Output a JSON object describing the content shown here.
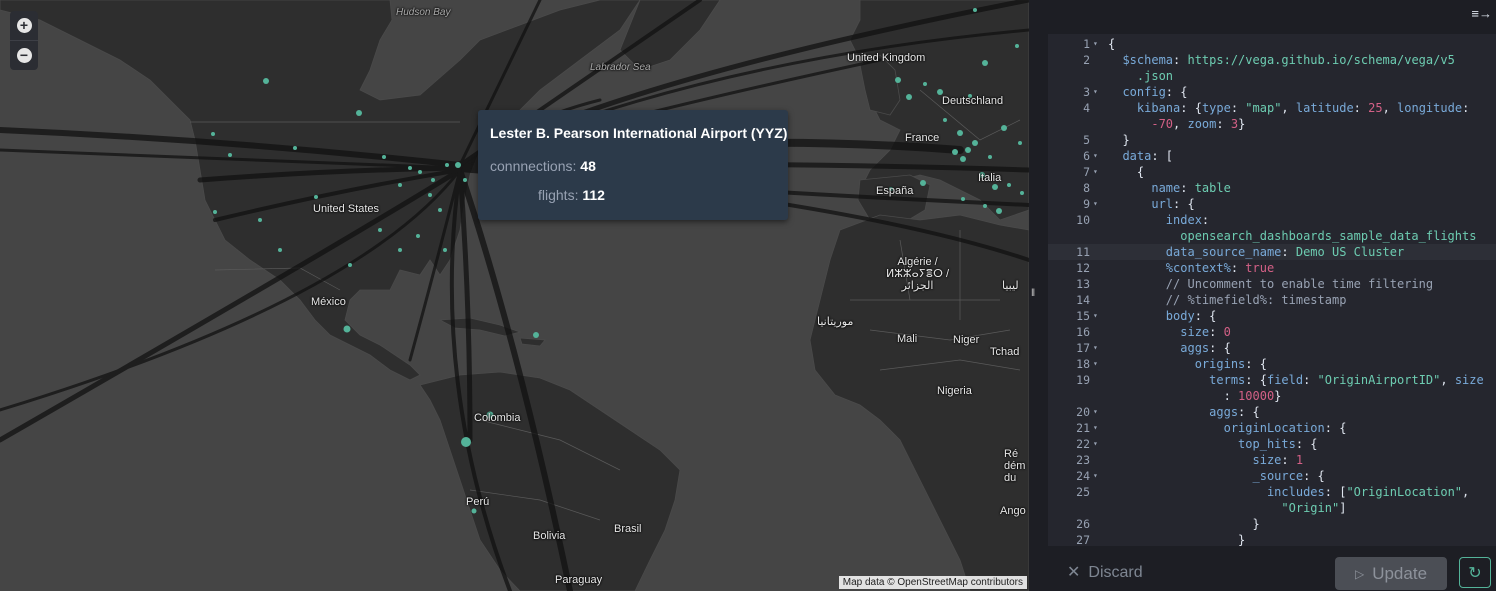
{
  "map": {
    "labels": {
      "hudson_bay": "Hudson\nBay",
      "labrador_sea": "Labrador\nSea",
      "united_kingdom": "United Kingdom",
      "deutschland": "Deutschland",
      "france": "France",
      "espana": "España",
      "italia": "Italia",
      "united_states": "United States",
      "mexico": "México",
      "algerie": "Algérie /\nⵍⵣⵣⴰⵢⴻⵔ /\nالجزائر",
      "libya": "ليبيا",
      "morocco": "موريتانيا",
      "mali": "Mali",
      "niger": "Niger",
      "tchad": "Tchad",
      "nigeria": "Nigeria",
      "colombia": "Colombia",
      "peru": "Perú",
      "bolivia": "Bolivia",
      "brasil": "Brasil",
      "paraguay": "Paraguay",
      "rdc": "Ré\ndém\ndu",
      "angola": "Ango"
    },
    "zoom_in_icon": "plus-icon",
    "zoom_out_icon": "minus-icon",
    "attribution": "Map data © OpenStreetMap contributors"
  },
  "tooltip": {
    "title": "Lester B. Pearson International Airport (YYZ)",
    "connections_label": "connnections:",
    "connections_value": "48",
    "flights_label": "flights:",
    "flights_value": "112"
  },
  "editor": {
    "lines": [
      {
        "n": "1",
        "fold": true
      },
      {
        "n": "2",
        "fold": false
      },
      {
        "n": "",
        "fold": false
      },
      {
        "n": "3",
        "fold": true
      },
      {
        "n": "4",
        "fold": false
      },
      {
        "n": "",
        "fold": false
      },
      {
        "n": "5",
        "fold": false
      },
      {
        "n": "6",
        "fold": true
      },
      {
        "n": "7",
        "fold": true
      },
      {
        "n": "8",
        "fold": false
      },
      {
        "n": "9",
        "fold": true
      },
      {
        "n": "10",
        "fold": false
      },
      {
        "n": "",
        "fold": false
      },
      {
        "n": "11",
        "fold": false
      },
      {
        "n": "12",
        "fold": false
      },
      {
        "n": "13",
        "fold": false
      },
      {
        "n": "14",
        "fold": false
      },
      {
        "n": "15",
        "fold": true
      },
      {
        "n": "16",
        "fold": false
      },
      {
        "n": "17",
        "fold": true
      },
      {
        "n": "18",
        "fold": true
      },
      {
        "n": "19",
        "fold": false
      },
      {
        "n": "",
        "fold": false
      },
      {
        "n": "20",
        "fold": true
      },
      {
        "n": "21",
        "fold": true
      },
      {
        "n": "22",
        "fold": true
      },
      {
        "n": "23",
        "fold": false
      },
      {
        "n": "24",
        "fold": true
      },
      {
        "n": "25",
        "fold": false
      },
      {
        "n": "",
        "fold": false
      },
      {
        "n": "26",
        "fold": false
      },
      {
        "n": "27",
        "fold": false
      }
    ],
    "code": [
      [
        [
          "b",
          "{"
        ]
      ],
      [
        [
          "k",
          "  $schema"
        ],
        [
          "b",
          ": "
        ],
        [
          "s",
          "https://vega.github.io/schema/vega/v5"
        ]
      ],
      [
        [
          "s",
          "    .json"
        ]
      ],
      [
        [
          "k",
          "  config"
        ],
        [
          "b",
          ": {"
        ]
      ],
      [
        [
          "k",
          "    kibana"
        ],
        [
          "b",
          ": {"
        ],
        [
          "k",
          "type"
        ],
        [
          "b",
          ": "
        ],
        [
          "s",
          "\"map\""
        ],
        [
          "b",
          ", "
        ],
        [
          "k",
          "latitude"
        ],
        [
          "b",
          ": "
        ],
        [
          "n",
          "25"
        ],
        [
          "b",
          ", "
        ],
        [
          "k",
          "longitude"
        ],
        [
          "b",
          ":"
        ]
      ],
      [
        [
          "n",
          "      -70"
        ],
        [
          "b",
          ", "
        ],
        [
          "k",
          "zoom"
        ],
        [
          "b",
          ": "
        ],
        [
          "n",
          "3"
        ],
        [
          "b",
          "}"
        ]
      ],
      [
        [
          "b",
          "  }"
        ]
      ],
      [
        [
          "k",
          "  data"
        ],
        [
          "b",
          ": ["
        ]
      ],
      [
        [
          "b",
          "    {"
        ]
      ],
      [
        [
          "k",
          "      name"
        ],
        [
          "b",
          ": "
        ],
        [
          "s",
          "table"
        ]
      ],
      [
        [
          "k",
          "      url"
        ],
        [
          "b",
          ": {"
        ]
      ],
      [
        [
          "k",
          "        index"
        ],
        [
          "b",
          ":"
        ]
      ],
      [
        [
          "s",
          "          opensearch_dashboards_sample_data_flights"
        ]
      ],
      [
        [
          "k",
          "        data_source_name"
        ],
        [
          "b",
          ": "
        ],
        [
          "s",
          "Demo US Cluster"
        ]
      ],
      [
        [
          "k",
          "        %context%"
        ],
        [
          "b",
          ": "
        ],
        [
          "n",
          "true"
        ]
      ],
      [
        [
          "c",
          "        // Uncomment to enable time filtering"
        ]
      ],
      [
        [
          "c",
          "        // %timefield%: timestamp"
        ]
      ],
      [
        [
          "k",
          "        body"
        ],
        [
          "b",
          ": {"
        ]
      ],
      [
        [
          "k",
          "          size"
        ],
        [
          "b",
          ": "
        ],
        [
          "n",
          "0"
        ]
      ],
      [
        [
          "k",
          "          aggs"
        ],
        [
          "b",
          ": {"
        ]
      ],
      [
        [
          "k",
          "            origins"
        ],
        [
          "b",
          ": {"
        ]
      ],
      [
        [
          "k",
          "              terms"
        ],
        [
          "b",
          ": {"
        ],
        [
          "k",
          "field"
        ],
        [
          "b",
          ": "
        ],
        [
          "s",
          "\"OriginAirportID\""
        ],
        [
          "b",
          ", "
        ],
        [
          "k",
          "size"
        ]
      ],
      [
        [
          "b",
          "                : "
        ],
        [
          "n",
          "10000"
        ],
        [
          "b",
          "}"
        ]
      ],
      [
        [
          "k",
          "              aggs"
        ],
        [
          "b",
          ": {"
        ]
      ],
      [
        [
          "k",
          "                originLocation"
        ],
        [
          "b",
          ": {"
        ]
      ],
      [
        [
          "k",
          "                  top_hits"
        ],
        [
          "b",
          ": {"
        ]
      ],
      [
        [
          "k",
          "                    size"
        ],
        [
          "b",
          ": "
        ],
        [
          "n",
          "1"
        ]
      ],
      [
        [
          "k",
          "                    _source"
        ],
        [
          "b",
          ": {"
        ]
      ],
      [
        [
          "k",
          "                      includes"
        ],
        [
          "b",
          ": ["
        ],
        [
          "s",
          "\"OriginLocation\""
        ],
        [
          "b",
          ","
        ]
      ],
      [
        [
          "s",
          "                        \"Origin\""
        ],
        [
          "b",
          "]"
        ]
      ],
      [
        [
          "b",
          "                    }"
        ]
      ],
      [
        [
          "b",
          "                  }"
        ]
      ]
    ],
    "highlight_line": "11"
  },
  "footer": {
    "discard_label": "Discard",
    "update_label": "Update",
    "refresh_icon": "refresh-icon"
  },
  "panel": {
    "collapse_icon": "collapse-panel-icon"
  },
  "colors": {
    "map_land": "#2e2e2e",
    "map_water": "#454545",
    "airport_dot": "#54b399",
    "tooltip_bg": "#2c3a4a",
    "editor_bg": "#25262e"
  }
}
